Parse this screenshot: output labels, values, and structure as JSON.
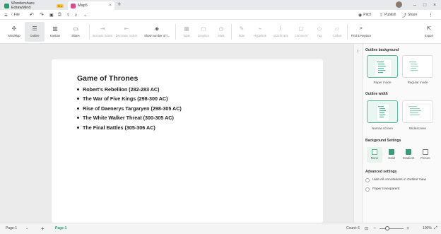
{
  "titlebar": {
    "app_tab": "Wondershare EdrawMind",
    "pro_badge": "Pro",
    "doc_tab": "Map5",
    "new_tab": "+"
  },
  "quickbar": {
    "file": "File",
    "pitch": "Pitch",
    "publish": "Publish",
    "share": "Share"
  },
  "ribbon": {
    "mindmap": "MindMap",
    "outline": "Outline",
    "kanban": "Kanban",
    "slides": "Slides",
    "increase_indent": "Increase Indent",
    "decrease_indent": "Decrease Indent",
    "show_number": "Show number of l...",
    "table": "Table",
    "graphics": "Graphics",
    "mark": "Mark",
    "note": "Note",
    "hyperlink": "Hyperlink",
    "attachment": "Attachment",
    "comment": "Comment",
    "tag": "Tag",
    "callout": "Callout",
    "find_replace": "Find & Replace",
    "export": "Export"
  },
  "outline": {
    "title": "Game of Thrones",
    "items": [
      "Robert's Rebellion (282-283 AC)",
      "The War of Five Kings (298-300 AC)",
      "Rise of Daenerys Targaryen (298-305 AC)",
      "The White Walker Threat (300-305 AC)",
      "The Final Battles (305-306 AC)"
    ]
  },
  "panel": {
    "outline_background": "Outline background",
    "paper_mode": "Paper mode",
    "regular_mode": "Regular mode",
    "outline_width": "Outline width",
    "narrow_screen": "Narrow screen",
    "widescreen": "Widescreen",
    "background_settings": "Background Settings",
    "bg_none": "None",
    "bg_solid": "Solid",
    "bg_gradient": "Gradient",
    "bg_picture": "Picture",
    "advanced_settings": "Advanced settings",
    "hide_annotations": "Hide All Annotations in Outline View",
    "paper_transparent": "Paper transparent"
  },
  "status": {
    "page_select": "Page-1",
    "add_page": "+",
    "active_page": "Page-1",
    "count": "Count: 6",
    "zoom": "100%"
  },
  "colors": {
    "accent": "#5cb89a",
    "app_icon": "#2e9a6f",
    "doc_icon": "#d94a8c"
  }
}
